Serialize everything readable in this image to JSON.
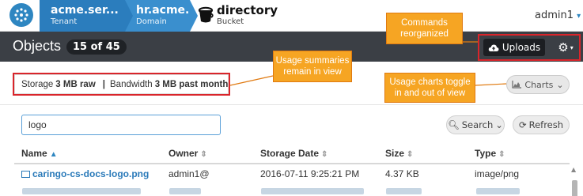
{
  "topbar": {
    "crumbs": [
      {
        "title": "acme.ser...",
        "subtitle": "Tenant"
      },
      {
        "title": "hr.acme.s..",
        "subtitle": "Domain"
      }
    ],
    "bucket": {
      "title": "directory",
      "subtitle": "Bucket"
    },
    "user": {
      "label": "admin1",
      "caret": "▾"
    }
  },
  "objects": {
    "title": "Objects",
    "count": "15 of 45",
    "uploads_label": "Uploads",
    "gear_icon": "gear-icon"
  },
  "usage": {
    "storage_label": "Storage",
    "storage_value": "3 MB raw",
    "separator": "|",
    "bandwidth_label": "Bandwidth",
    "bandwidth_value": "3 MB past month"
  },
  "charts_label": "Charts",
  "search": {
    "value": "logo",
    "button_label": "Search",
    "refresh_label": "Refresh"
  },
  "table": {
    "columns": [
      "Name",
      "Owner",
      "Storage Date",
      "Size",
      "Type"
    ],
    "rows": [
      {
        "name": "caringo-cs-docs-logo.png",
        "owner": "admin1@",
        "date": "2016-07-11 9:25:21 PM",
        "size": "4.37 KB",
        "type": "image/png"
      }
    ]
  },
  "callouts": {
    "commands": "Commands reorganized",
    "usage": "Usage summaries remain in view",
    "charts": "Usage charts toggle in and out of view"
  },
  "colors": {
    "brand": "#2e86c1",
    "dark_bar": "#3b3f45",
    "callout": "#f6a523",
    "highlight": "#d9252b"
  }
}
